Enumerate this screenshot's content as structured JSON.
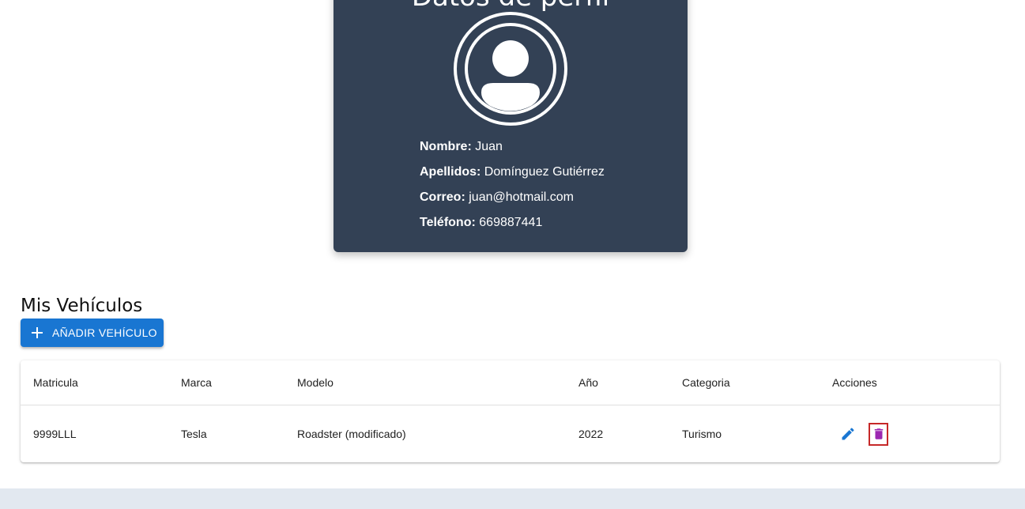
{
  "profile": {
    "title": "Datos de perfil",
    "fields": [
      {
        "label": "Nombre:",
        "value": "Juan"
      },
      {
        "label": "Apellidos:",
        "value": "Domínguez Gutiérrez"
      },
      {
        "label": "Correo:",
        "value": "juan@hotmail.com"
      },
      {
        "label": "Teléfono:",
        "value": "669887441"
      }
    ],
    "avatar_icon": "user-avatar-icon"
  },
  "vehicles": {
    "title": "Mis Vehículos",
    "add_button_label": "AÑADIR VEHÍCULO",
    "columns": [
      "Matricula",
      "Marca",
      "Modelo",
      "Año",
      "Categoria",
      "Acciones"
    ],
    "rows": [
      {
        "matricula": "9999LLL",
        "marca": "Tesla",
        "modelo": "Roadster (modificado)",
        "anio": "2022",
        "categoria": "Turismo"
      }
    ]
  },
  "colors": {
    "card_background": "#334155",
    "primary": "#1976d2",
    "delete_icon": "#9c27b0",
    "delete_highlight": "#c62828",
    "footer": "#e2e8f0"
  }
}
